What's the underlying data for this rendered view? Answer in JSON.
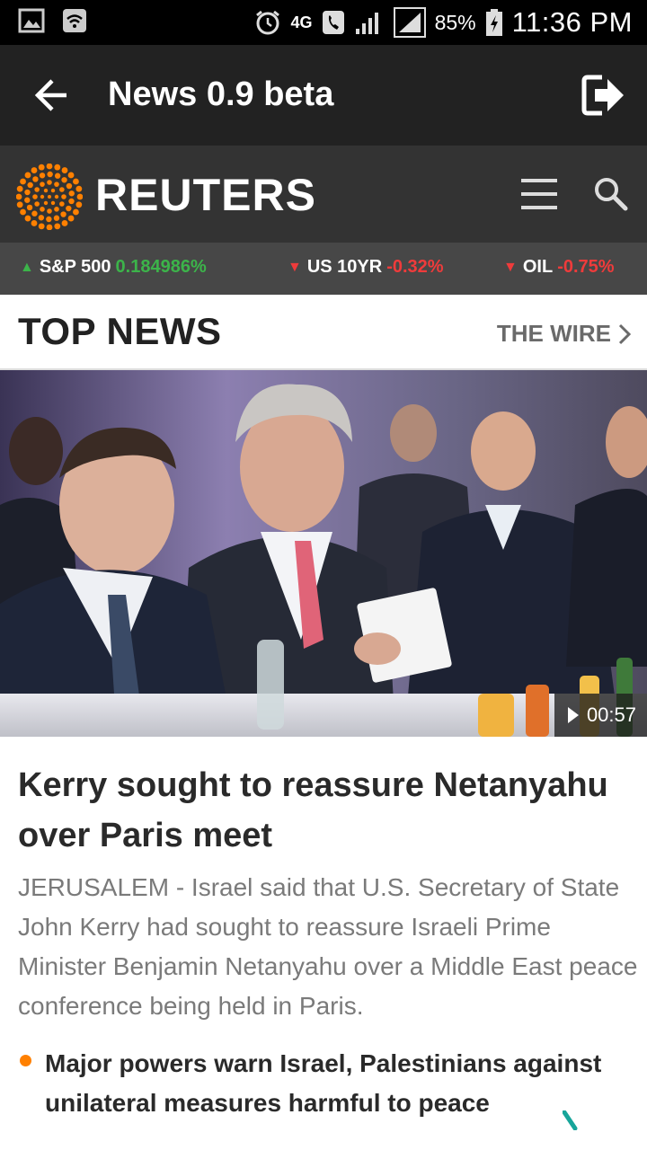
{
  "status_bar": {
    "battery_percent": "85%",
    "time": "11:36 PM",
    "network": "4G"
  },
  "app_bar": {
    "title": "News 0.9 beta"
  },
  "brand": {
    "name": "REUTERS",
    "accent_color": "#ff8000"
  },
  "ticker": [
    {
      "name": "S&P 500",
      "value": "0.184986%",
      "direction": "up"
    },
    {
      "name": "US 10YR",
      "value": "-0.32%",
      "direction": "down"
    },
    {
      "name": "OIL",
      "value": "-0.75%",
      "direction": "down"
    }
  ],
  "section": {
    "title": "TOP NEWS",
    "wire_link": "THE WIRE"
  },
  "hero": {
    "video_duration": "00:57"
  },
  "article": {
    "headline": "Kerry sought to reassure Netanyahu over Paris meet",
    "summary": "JERUSALEM - Israel said that U.S. Secretary of State John Kerry had sought to reassure Israeli Prime Minister Benjamin Netanyahu over a Middle East peace conference being held in Paris.",
    "related": [
      "Major powers warn Israel, Palestinians against unilateral measures harmful to peace"
    ]
  }
}
